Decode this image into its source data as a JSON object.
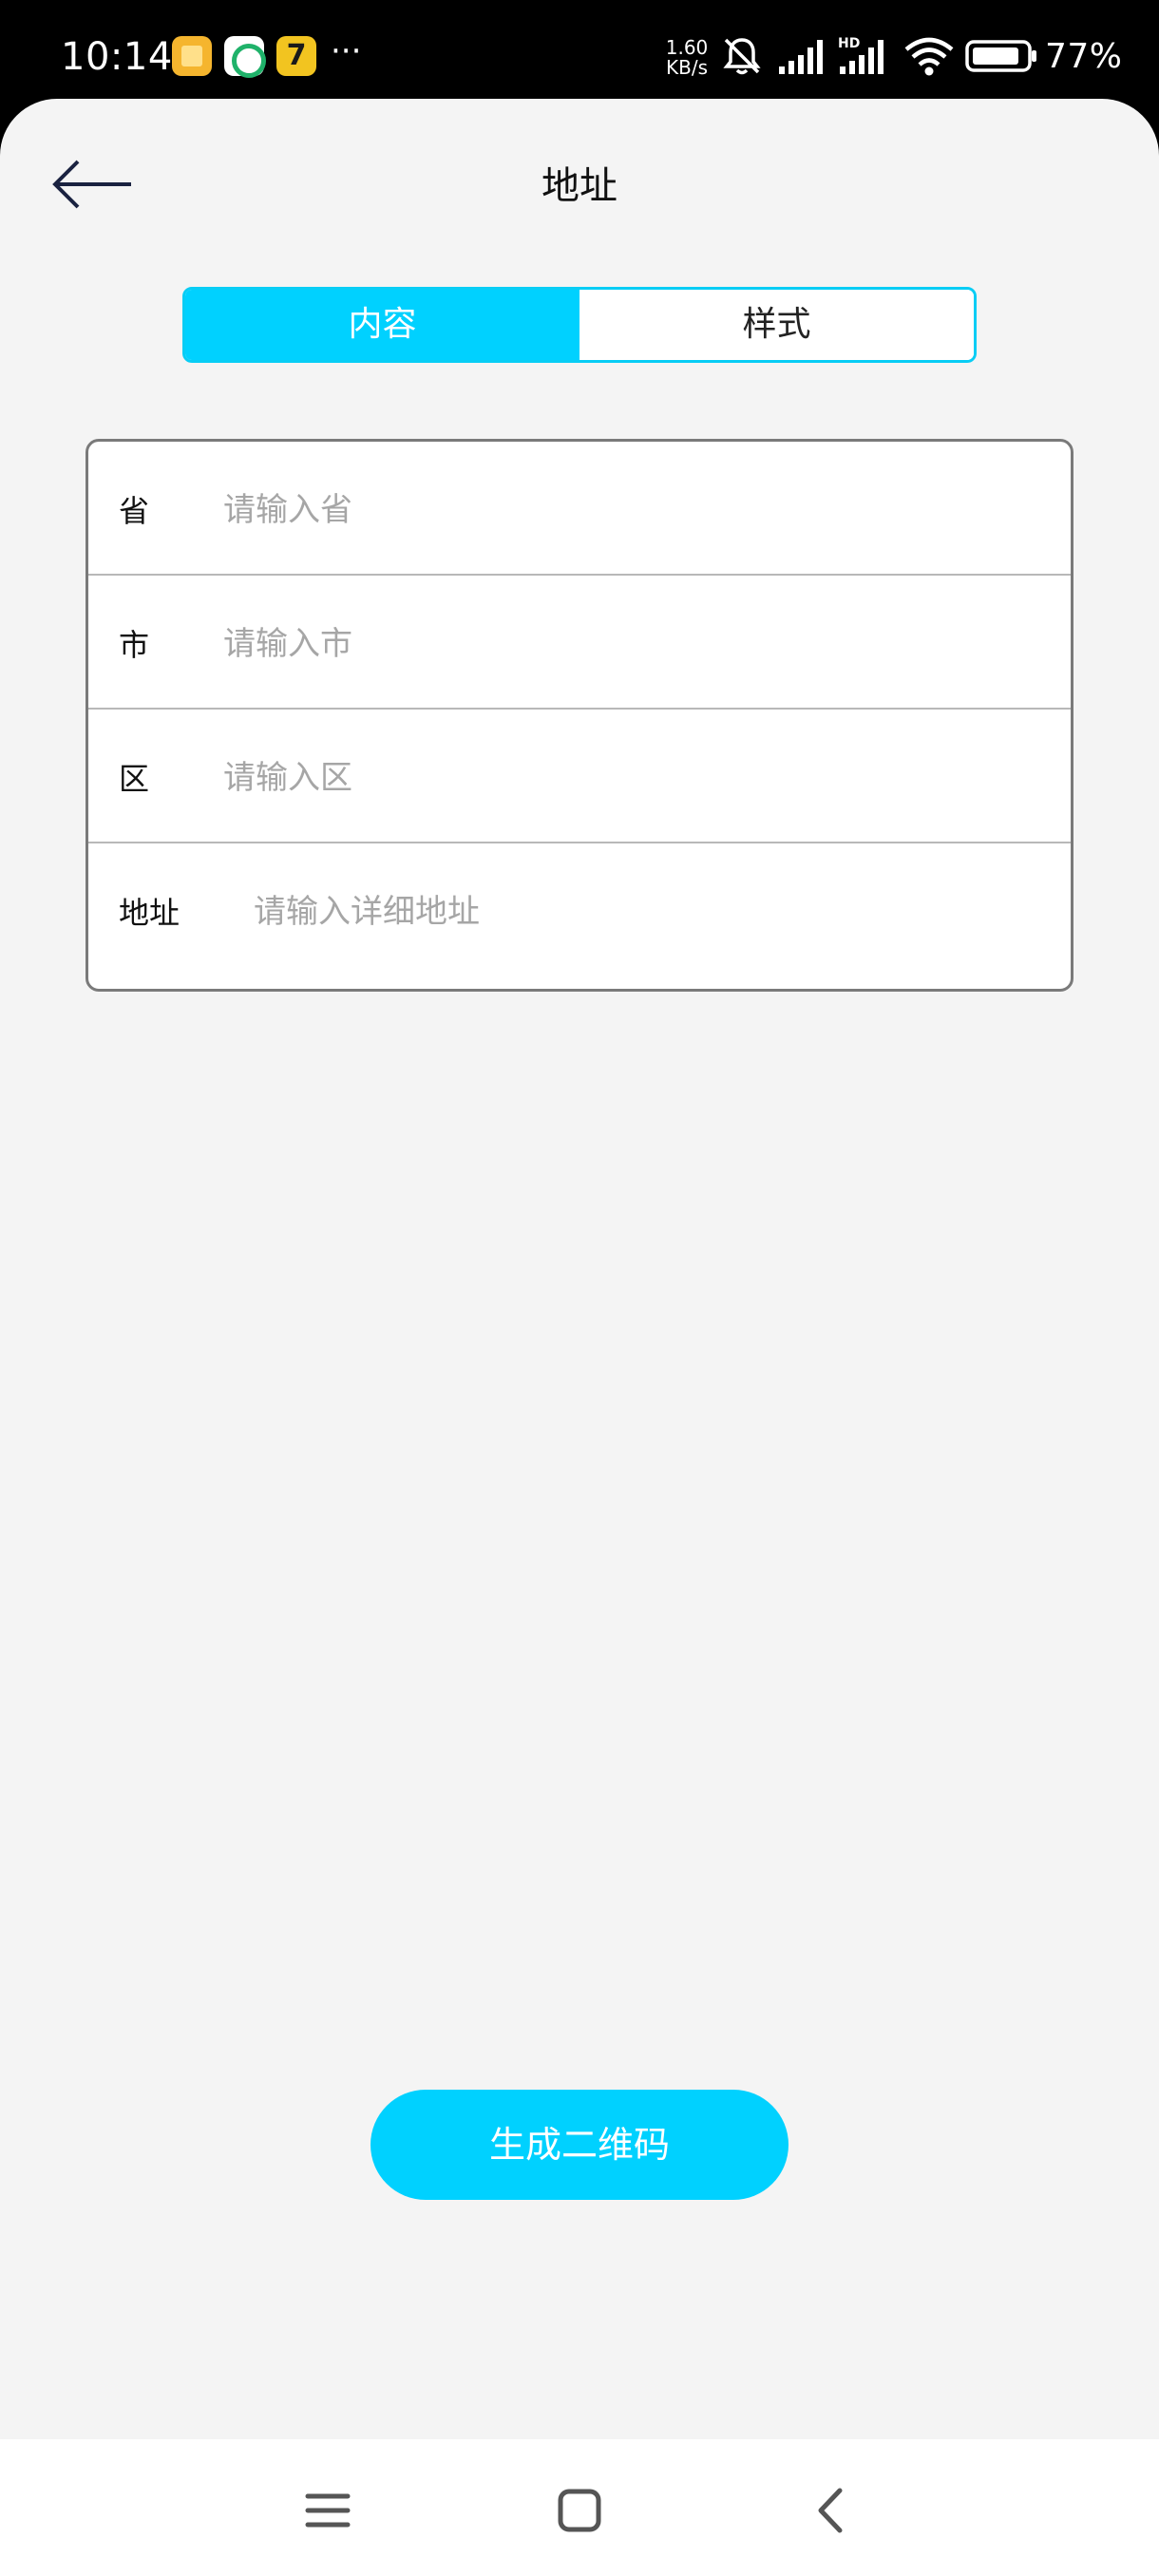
{
  "status_bar": {
    "time": "10:14",
    "more": "···",
    "net_speed_value": "1.60",
    "net_speed_unit": "KB/s",
    "battery": "77%",
    "icons": [
      "app-icon-notes",
      "app-icon-green",
      "app-icon-7",
      "mute-bell-icon",
      "signal-icon",
      "hd-signal-icon",
      "wifi-icon",
      "battery-icon"
    ]
  },
  "header": {
    "title": "地址",
    "back_icon": "back-arrow-icon"
  },
  "segment": {
    "tabs": [
      {
        "label": "内容",
        "active": true
      },
      {
        "label": "样式",
        "active": false
      }
    ]
  },
  "form": {
    "rows": [
      {
        "label": "省",
        "placeholder": "请输入省",
        "value": ""
      },
      {
        "label": "市",
        "placeholder": "请输入市",
        "value": ""
      },
      {
        "label": "区",
        "placeholder": "请输入区",
        "value": ""
      },
      {
        "label": "地址",
        "placeholder": "请输入详细地址",
        "value": ""
      }
    ]
  },
  "generate_button": {
    "label": "生成二维码"
  },
  "colors": {
    "accent": "#00d1ff",
    "page_bg": "#f4f4f4",
    "card_border": "#7a7a7a"
  },
  "nav_bar": {
    "icons": [
      "menu-icon",
      "home-icon",
      "back-icon"
    ]
  }
}
